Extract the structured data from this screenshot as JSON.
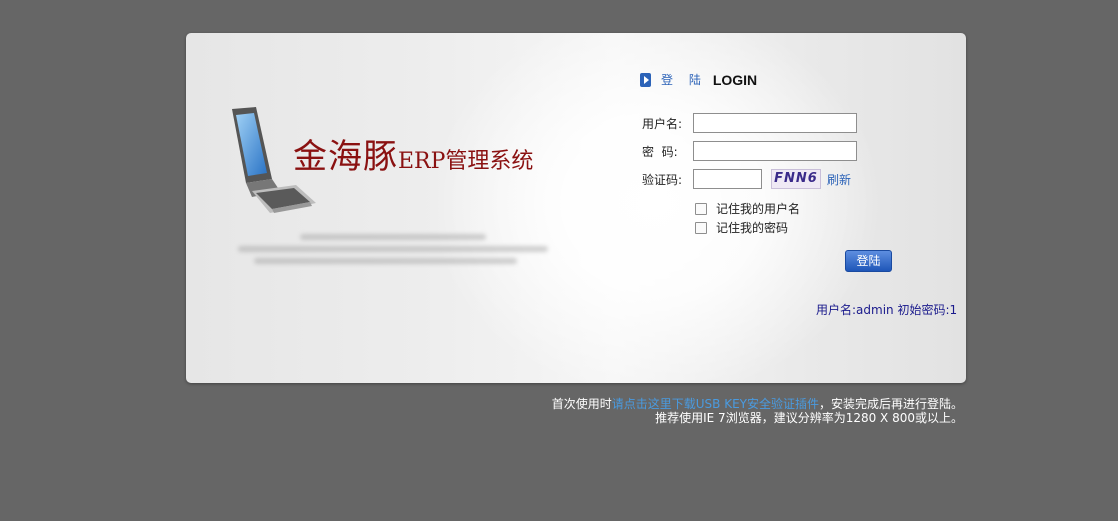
{
  "brand": {
    "title_cn": "金海豚",
    "title_suffix": "ERP管理系统"
  },
  "login": {
    "heading_cn": "登 陆",
    "heading_en": "LOGIN",
    "username_label": "用户名:",
    "password_label": "密  码:",
    "captcha_label": "验证码:",
    "username_value": "",
    "password_value": "",
    "captcha_value": "",
    "captcha_image_text": "FNN6",
    "refresh_label": "刷新",
    "remember_user_label": "记住我的用户名",
    "remember_password_label": "记住我的密码",
    "submit_label": "登陆",
    "hint_prefix": "用户名:",
    "hint_user": "admin",
    "hint_pwd_prefix": "初始密码:",
    "hint_pwd": "1"
  },
  "footer": {
    "line1_prefix": "首次使用时",
    "line1_link": "请点击这里下载USB KEY安全验证插件",
    "line1_suffix": "，安装完成后再进行登陆。",
    "line2": "推荐使用IE 7浏览器，建议分辨率为1280 X 800或以上。"
  },
  "colors": {
    "background": "#666666",
    "accent": "#2c63b8",
    "brand": "#8a1111"
  }
}
